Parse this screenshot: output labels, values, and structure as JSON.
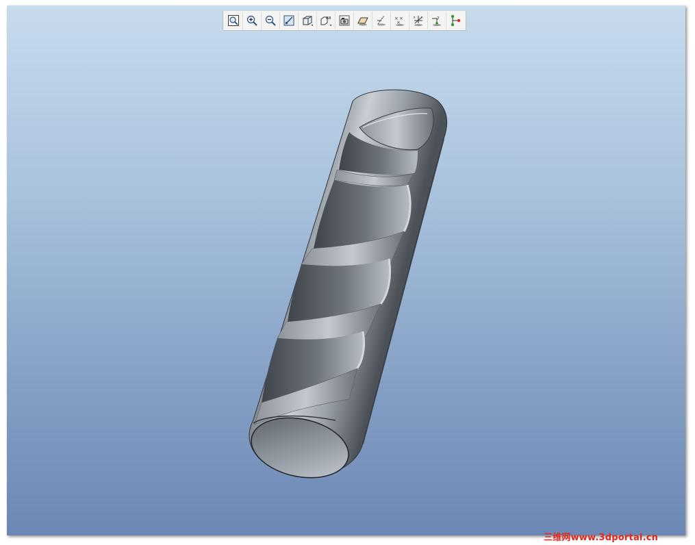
{
  "toolbar": {
    "buttons": [
      {
        "icon": "refit-icon"
      },
      {
        "icon": "zoom-in-icon"
      },
      {
        "icon": "zoom-out-icon"
      },
      {
        "icon": "repaint-icon"
      },
      {
        "icon": "display-style-icon"
      },
      {
        "icon": "saved-views-icon"
      },
      {
        "icon": "layers-icon"
      },
      {
        "icon": "datum-planes-icon"
      },
      {
        "icon": "datum-axes-icon"
      },
      {
        "icon": "datum-points-icon"
      },
      {
        "icon": "coordinate-systems-icon"
      },
      {
        "icon": "annotations-icon"
      },
      {
        "icon": "spin-center-icon"
      }
    ]
  },
  "watermark": {
    "text": "三维网www.3dportal.cn",
    "color": "#e0291f"
  },
  "colors": {
    "background_top": "#c7dbec",
    "background_bottom": "#6c87b3",
    "part_fill": "#8e949b"
  }
}
